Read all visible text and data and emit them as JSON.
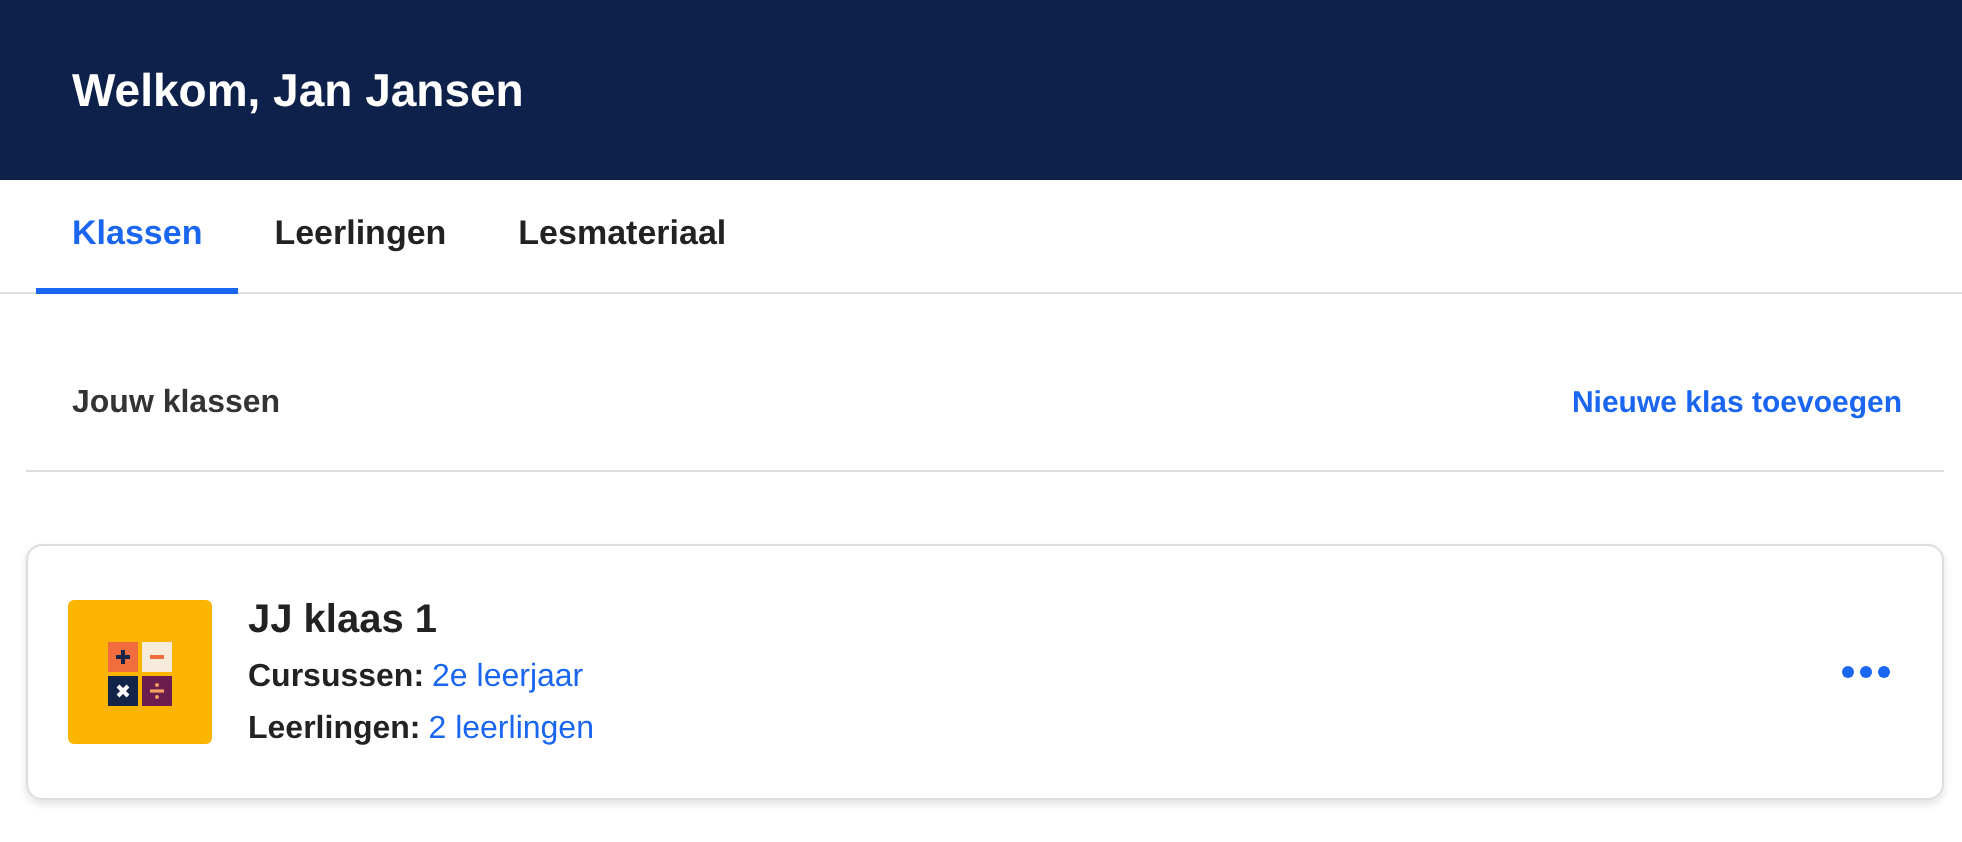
{
  "header": {
    "title": "Welkom, Jan Jansen"
  },
  "tabs": [
    {
      "label": "Klassen",
      "selected": true
    },
    {
      "label": "Leerlingen",
      "selected": false
    },
    {
      "label": "Lesmateriaal",
      "selected": false
    }
  ],
  "section": {
    "title": "Jouw klassen",
    "action": "Nieuwe klas toevoegen"
  },
  "classes": [
    {
      "name": "JJ klaas 1",
      "fields": [
        {
          "label": "Cursussen:",
          "value": "2e leerjaar"
        },
        {
          "label": "Leerlingen:",
          "value": "2 leerlingen"
        }
      ]
    }
  ]
}
